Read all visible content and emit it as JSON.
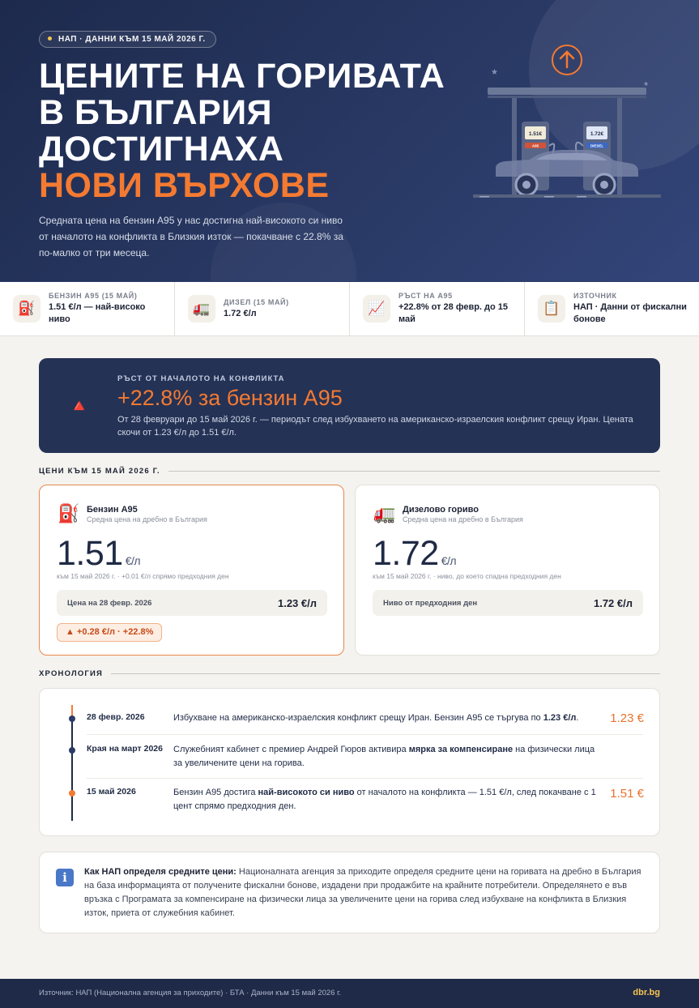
{
  "hero": {
    "badge": "НАП · ДАННИ КЪМ 15 МАЙ 2026 Г.",
    "title_line1": "ЦЕНИТЕ НА ГОРИВАТА",
    "title_line2": "В БЪЛГАРИЯ",
    "title_line3": "ДОСТИГНАХА",
    "title_accent": "НОВИ ВЪРХОВЕ",
    "description": "Средната цена на бензин А95 у нас достигна най-високото си ниво от началото на конфликта в Близкия изток — покачване с 22.8% за по-малко от три месеца.",
    "pump_a95_price": "1.51€",
    "pump_a95_label": "A95",
    "pump_diesel_price": "1.72€",
    "pump_diesel_label": "DIESEL"
  },
  "stats": [
    {
      "label": "БЕНЗИН А95 (15 МАЙ)",
      "value": "1.51 €/л — най-високо ниво",
      "icon": "fuel-pump-icon"
    },
    {
      "label": "ДИЗЕЛ (15 МАЙ)",
      "value": "1.72 €/л",
      "icon": "truck-icon"
    },
    {
      "label": "РЪСТ НА А95",
      "value": "+22.8% от 28 февр. до 15 май",
      "icon": "chart-up-icon"
    },
    {
      "label": "ИЗТОЧНИК",
      "value": "НАП · Данни от фискални бонове",
      "icon": "clipboard-icon"
    }
  ],
  "banner": {
    "label": "РЪСТ ОТ НАЧАЛОТО НА КОНФЛИКТА",
    "title": "+22.8% за бензин А95",
    "text": "От 28 февруари до 15 май 2026 г. — периодът след избухването на американско-израелския конфликт срещу Иран. Цената скочи от 1.23 €/л до 1.51 €/л."
  },
  "prices_section": {
    "heading": "ЦЕНИ КЪМ 15 МАЙ 2026 Г."
  },
  "cards": {
    "a95": {
      "name": "Бензин А95",
      "sub": "Средна цена на дребно в България",
      "price": "1.51",
      "unit": "€/л",
      "note": "към 15 май 2026 г. · +0.01 €/л спрямо предходния ден",
      "row_label": "Цена на 28 февр. 2026",
      "row_value": "1.23 €/л",
      "chip": "▲ +0.28 €/л  ·  +22.8%"
    },
    "diesel": {
      "name": "Дизелово гориво",
      "sub": "Средна цена на дребно в България",
      "price": "1.72",
      "unit": "€/л",
      "note": "към 15 май 2026 г. · ниво, до което спадна предходния ден",
      "row_label": "Ниво от предходния ден",
      "row_value": "1.72 €/л"
    }
  },
  "timeline_section": {
    "heading": "ХРОНОЛОГИЯ"
  },
  "timeline": [
    {
      "date": "28 февр. 2026",
      "text_pre": "Избухване на американско-израелския конфликт срещу Иран. Бензин А95 се търгува по ",
      "text_bold": "1.23 €/л",
      "text_post": ".",
      "price": "1.23 €"
    },
    {
      "date": "Края на март 2026",
      "text_pre": "Служебният кабинет с премиер Андрей Гюров активира ",
      "text_bold": "мярка за компенсиране",
      "text_post": " на физически лица за увеличените цени на горива.",
      "price": ""
    },
    {
      "date": "15 май 2026",
      "text_pre": "Бензин А95 достига ",
      "text_bold": "най-високото си ниво",
      "text_post": " от началото на конфликта — 1.51 €/л, след покачване с 1 цент спрямо предходния ден.",
      "price": "1.51 €"
    }
  ],
  "info": {
    "bold": "Как НАП определя средните цени:",
    "text": " Националната агенция за приходите определя средните цени на горивата на дребно в България на база информацията от получените фискални бонове, издадени при продажбите на крайните потребители. Определянето е във връзка с Програмата за компенсиране на физически лица за увеличените цени на горива след избухване на конфликта в Близкия изток, приета от служебния кабинет."
  },
  "footer": {
    "source": "Източник: НАП (Национална агенция за приходите) · БТА · Данни към 15 май 2026 г.",
    "brand": "dbr.bg"
  }
}
